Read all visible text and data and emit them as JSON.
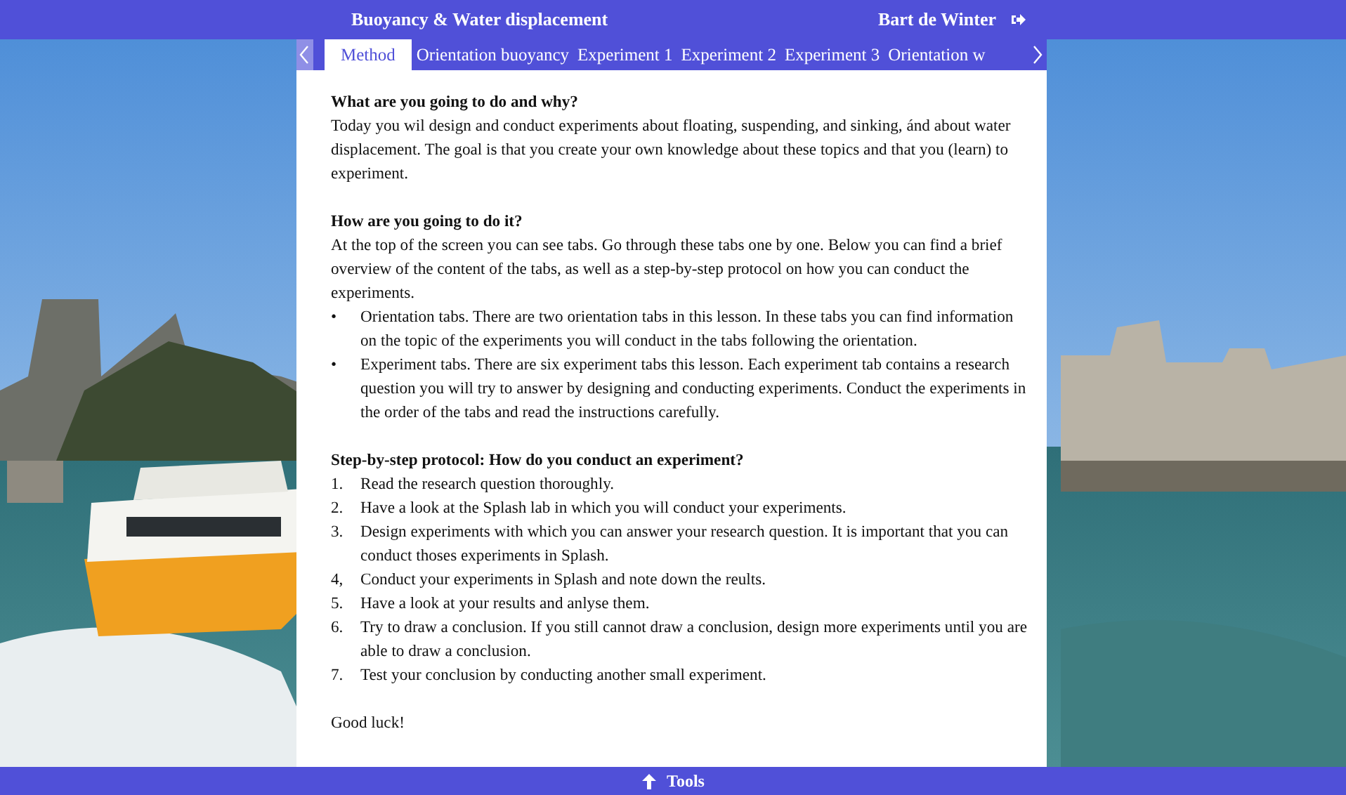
{
  "header": {
    "title": "Buoyancy & Water displacement",
    "user": "Bart de Winter"
  },
  "tabs": [
    {
      "label": "Method",
      "selected": true
    },
    {
      "label": "Orientation buoyancy",
      "selected": false
    },
    {
      "label": "Experiment 1",
      "selected": false
    },
    {
      "label": "Experiment 2",
      "selected": false
    },
    {
      "label": "Experiment 3",
      "selected": false
    },
    {
      "label": "Orientation w",
      "selected": false
    }
  ],
  "sections": [
    {
      "heading": "What are you going to do and why?",
      "paragraph": "Today you wil design and conduct experiments about floating, suspending, and sinking, ánd about water displacement. The goal is that you create your own knowledge about these topics and that you (learn) to experiment."
    },
    {
      "heading": "How are you going to do it?",
      "paragraph": "At the top of the screen you can see tabs. Go through these tabs one by one. Below you can find a brief overview of the content of the tabs, as well as a step-by-step protocol on how you can conduct the experiments.",
      "list": [
        {
          "marker": "•",
          "text": "Orientation tabs. There are two orientation tabs in this lesson. In these tabs you can find information on the topic of the experiments you will conduct in the tabs following the orientation."
        },
        {
          "marker": "•",
          "text": "Experiment tabs. There are six experiment tabs this lesson. Each experiment tab contains a research question you will try to answer by designing and conducting experiments. Conduct the experiments in the order of the tabs and read the instructions carefully."
        }
      ]
    },
    {
      "heading": "Step-by-step protocol: How do you conduct an experiment?",
      "list": [
        {
          "marker": "1.",
          "text": "Read the research question thoroughly."
        },
        {
          "marker": "2.",
          "text": "Have a look at the Splash lab in which you will conduct your experiments."
        },
        {
          "marker": "3.",
          "text": "Design experiments with which you can answer your research question. It is important that you can conduct thoses experiments in Splash."
        },
        {
          "marker": "4,",
          "text": "Conduct your experiments in Splash and note down the reults."
        },
        {
          "marker": "5.",
          "text": "Have a look at your results and anlyse them."
        },
        {
          "marker": "6.",
          "text": "Try to draw a conclusion. If you still cannot draw a conclusion, design more experiments until you are able to draw a conclusion."
        },
        {
          "marker": "7.",
          "text": "Test your conclusion by conducting another small experiment."
        }
      ]
    },
    {
      "paragraph": "Good luck!"
    }
  ],
  "footer": {
    "label": "Tools"
  }
}
